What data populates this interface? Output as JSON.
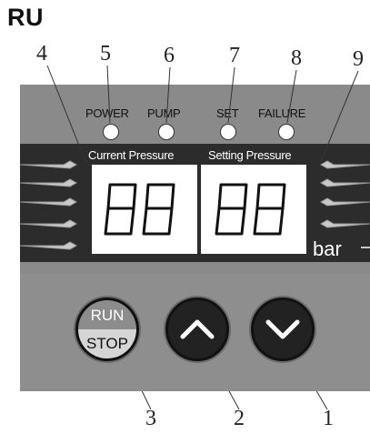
{
  "title": "RU",
  "callouts": [
    "1",
    "2",
    "3",
    "4",
    "5",
    "6",
    "7",
    "8",
    "9"
  ],
  "indicators": [
    {
      "label": "POWER"
    },
    {
      "label": "PUMP"
    },
    {
      "label": "SET"
    },
    {
      "label": "FAILURE"
    }
  ],
  "displays": {
    "current_label": "Current Pressure",
    "setting_label": "Setting Pressure",
    "unit": "bar"
  },
  "buttons": {
    "run": "RUN",
    "stop": "STOP",
    "up_icon": "chevron-up-icon",
    "down_icon": "chevron-down-icon"
  },
  "colors": {
    "panel": "#8a8a8a",
    "band": "#2c2c2c",
    "screen": "#ffffff",
    "button": "#222222"
  }
}
